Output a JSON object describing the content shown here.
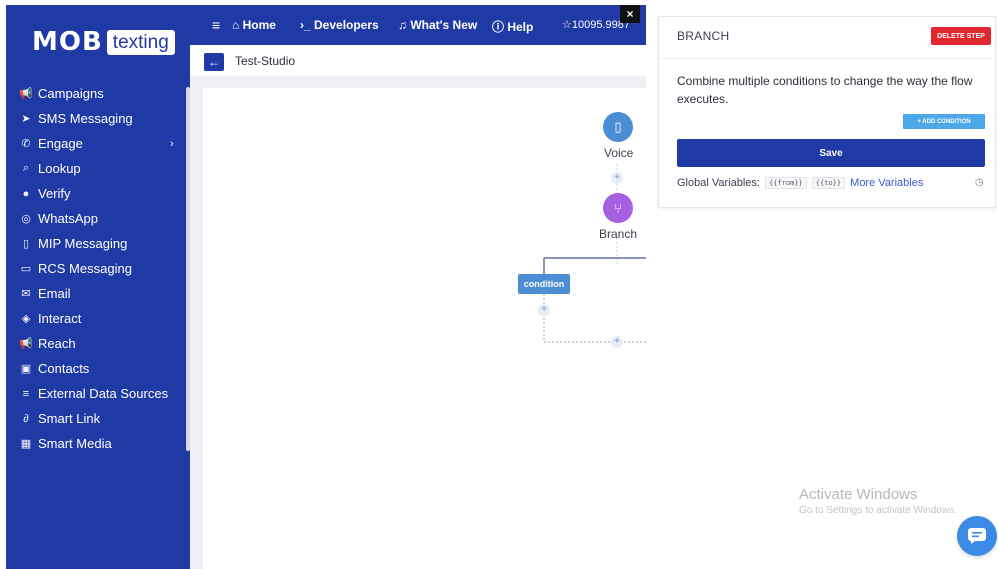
{
  "brand": {
    "logo_mob": "MOB",
    "logo_texting": "texting"
  },
  "sidebar": {
    "items": [
      {
        "label": "Campaigns",
        "icon": "megaphone-icon",
        "glyph": "📢"
      },
      {
        "label": "SMS Messaging",
        "icon": "send-icon",
        "glyph": "➤"
      },
      {
        "label": "Engage",
        "icon": "engage-icon",
        "glyph": "✆",
        "chevron": "›"
      },
      {
        "label": "Lookup",
        "icon": "search-icon",
        "glyph": "⌕"
      },
      {
        "label": "Verify",
        "icon": "verify-icon",
        "glyph": "●"
      },
      {
        "label": "WhatsApp",
        "icon": "whatsapp-icon",
        "glyph": "◎"
      },
      {
        "label": "MIP Messaging",
        "icon": "mobile-icon",
        "glyph": "▯"
      },
      {
        "label": "RCS Messaging",
        "icon": "chat-icon",
        "glyph": "▭"
      },
      {
        "label": "Email",
        "icon": "email-icon",
        "glyph": "✉"
      },
      {
        "label": "Interact",
        "icon": "ticket-icon",
        "glyph": "◈"
      },
      {
        "label": "Reach",
        "icon": "megaphone-icon",
        "glyph": "📢"
      },
      {
        "label": "Contacts",
        "icon": "contacts-icon",
        "glyph": "▣"
      },
      {
        "label": "External Data Sources",
        "icon": "database-icon",
        "glyph": "≡"
      },
      {
        "label": "Smart Link",
        "icon": "link-icon",
        "glyph": "∂"
      },
      {
        "label": "Smart Media",
        "icon": "media-icon",
        "glyph": "▦"
      }
    ]
  },
  "topbar": {
    "home": "⌂ Home",
    "developers": "›_ Developers",
    "whats_new": "♫ What's New",
    "help": "ⓘ Help",
    "balance": "☆10095.9987",
    "close": "×"
  },
  "subheader": {
    "back": "←",
    "title": "Test-Studio"
  },
  "canvas": {
    "voice_label": "Voice",
    "branch_label": "Branch",
    "condition_label": "condition",
    "plus": "+"
  },
  "panel": {
    "title": "BRANCH",
    "delete_label": "DELETE STEP",
    "description": "Combine multiple conditions to change the way the flow executes.",
    "add_condition_label": "+ ADD CONDITION",
    "save_label": "Save",
    "global_vars_label": "Global Variables:",
    "var_from": "{{from}}",
    "var_to": "{{to}}",
    "more_vars_label": "More Variables",
    "help_glyph": "◷"
  },
  "watermark": {
    "line1": "Activate Windows",
    "line2": "Go to Settings to activate Windows."
  },
  "colors": {
    "primary": "#1f3aa5",
    "danger": "#e0262f",
    "voice": "#4c8ed6",
    "branch": "#a55fe0"
  }
}
